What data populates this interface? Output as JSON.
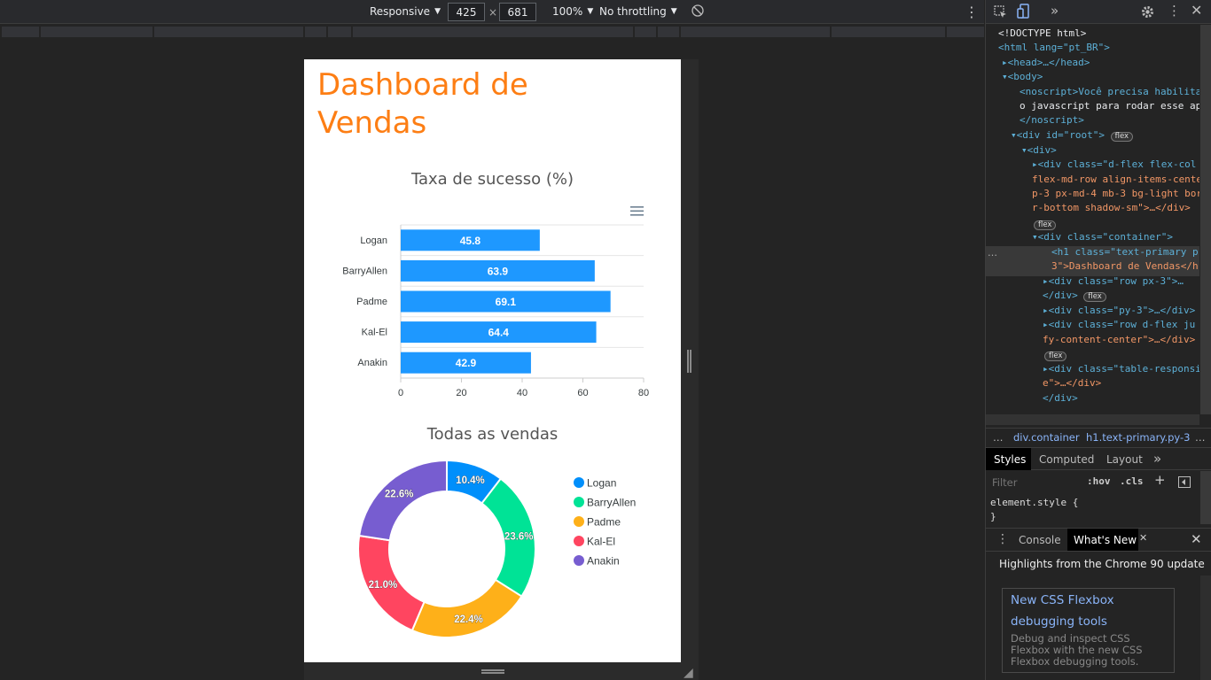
{
  "toolbar": {
    "device": "Responsive",
    "width": "425",
    "times": "×",
    "height": "681",
    "zoom": "100%",
    "throttling": "No throttling"
  },
  "page": {
    "title": "Dashboard de Vendas",
    "title_color": "#fd7e14"
  },
  "chart_data": [
    {
      "type": "bar",
      "orientation": "horizontal",
      "title": "Taxa de sucesso (%)",
      "categories": [
        "Logan",
        "BarryAllen",
        "Padme",
        "Kal-El",
        "Anakin"
      ],
      "values": [
        45.8,
        63.9,
        69.1,
        64.4,
        42.9
      ],
      "xlim": [
        0,
        80
      ],
      "xticks": [
        "0",
        "20",
        "40",
        "60",
        "80"
      ],
      "color": "#1e98ff",
      "grid": true,
      "data_labels": [
        "45.8",
        "63.9",
        "69.1",
        "64.4",
        "42.9"
      ]
    },
    {
      "type": "pie",
      "variant": "donut",
      "title": "Todas as vendas",
      "labels": [
        "Logan",
        "BarryAllen",
        "Padme",
        "Kal-El",
        "Anakin"
      ],
      "values": [
        10.4,
        23.6,
        22.4,
        21.0,
        22.6
      ],
      "data_labels": [
        "10.4%",
        "23.6%",
        "22.4%",
        "21.0%",
        "22.6%"
      ],
      "colors": [
        "#008ffb",
        "#00e396",
        "#feb019",
        "#ff4560",
        "#775dd0"
      ],
      "legend_position": "right"
    }
  ],
  "devtools": {
    "elements_lines": [
      "<!DOCTYPE html>",
      "<html lang=\"pt_BR\">",
      "▸<head>…</head>",
      "▾<body>",
      "<noscript>Você precisa habilita",
      "o javascript para rodar esse ap",
      "</noscript>",
      "▾<div id=\"root\">",
      "▾<div>",
      "▸<div class=\"d-flex flex-col",
      "flex-md-row align-items-cente",
      "p-3 px-md-4 mb-3 bg-light bor",
      "r-bottom shadow-sm\">…</div>",
      "▾<div class=\"container\">",
      "<h1 class=\"text-primary p",
      "3\">Dashboard de Vendas</h",
      "▸<div class=\"row px-3\">…",
      "</div>",
      "▸<div class=\"py-3\">…</div>",
      "▸<div class=\"row d-flex ju",
      "fy-content-center\">…</div>",
      "▸<div class=\"table-responsi",
      "e\">…</div>",
      "</div>"
    ],
    "badge": "flex",
    "ellipsis": "…",
    "breadcrumbs": [
      "div.container",
      "h1.text-primary.py-3"
    ],
    "panel_tabs": [
      "Styles",
      "Computed",
      "Layout"
    ],
    "filter_placeholder": "Filter",
    "hov": ":hov",
    "cls": ".cls",
    "element_style": "element.style {",
    "element_style_close": "}",
    "drawer_tabs": [
      "Console",
      "What's New"
    ],
    "whats_new_heading": "Highlights from the Chrome 90 update",
    "card_title_line1": "New CSS Flexbox",
    "card_title_line2": "debugging tools",
    "card_desc": "Debug and inspect CSS Flexbox with the new CSS Flexbox debugging tools."
  }
}
